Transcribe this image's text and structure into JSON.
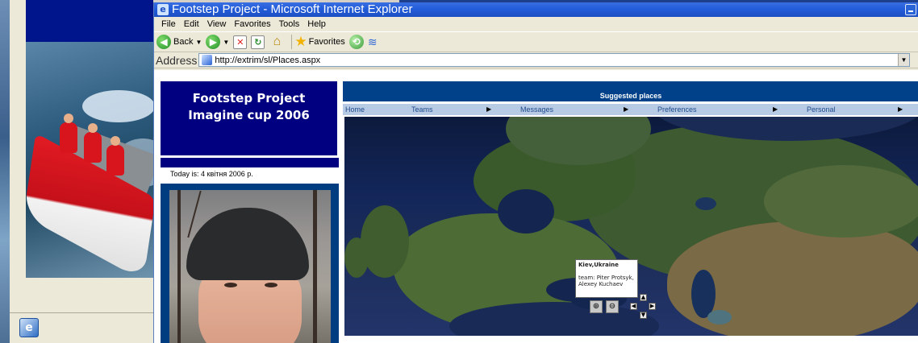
{
  "window": {
    "title": "Footstep Project - Microsoft Internet Explorer"
  },
  "menu": [
    "File",
    "Edit",
    "View",
    "Favorites",
    "Tools",
    "Help"
  ],
  "toolbar": {
    "back_label": "Back",
    "favorites_label": "Favorites"
  },
  "address": {
    "label": "Address",
    "url": "http://extrim/sl/Places.aspx"
  },
  "page": {
    "logo_line1": "Footstep Project",
    "logo_line2": "Imagine cup 2006",
    "today": "Today is: 4 квітня 2006 р.",
    "header": "Suggested places",
    "nav": [
      {
        "label": "Home"
      },
      {
        "label": "Teams"
      },
      {
        "label": "Messages"
      },
      {
        "label": "Preferences"
      },
      {
        "label": "Personal"
      }
    ],
    "tooltip": {
      "title": "Kiev,Ukraine",
      "body": "team: Piter Protsyk, Alexey Kuchaev"
    }
  },
  "icons": [
    "back-icon",
    "forward-icon",
    "stop-icon",
    "refresh-icon",
    "home-icon",
    "favorites-star-icon",
    "history-icon",
    "media-icon",
    "zoom-in-icon",
    "zoom-out-icon",
    "pan-up-icon",
    "pan-down-icon",
    "pan-left-icon",
    "pan-right-icon"
  ]
}
